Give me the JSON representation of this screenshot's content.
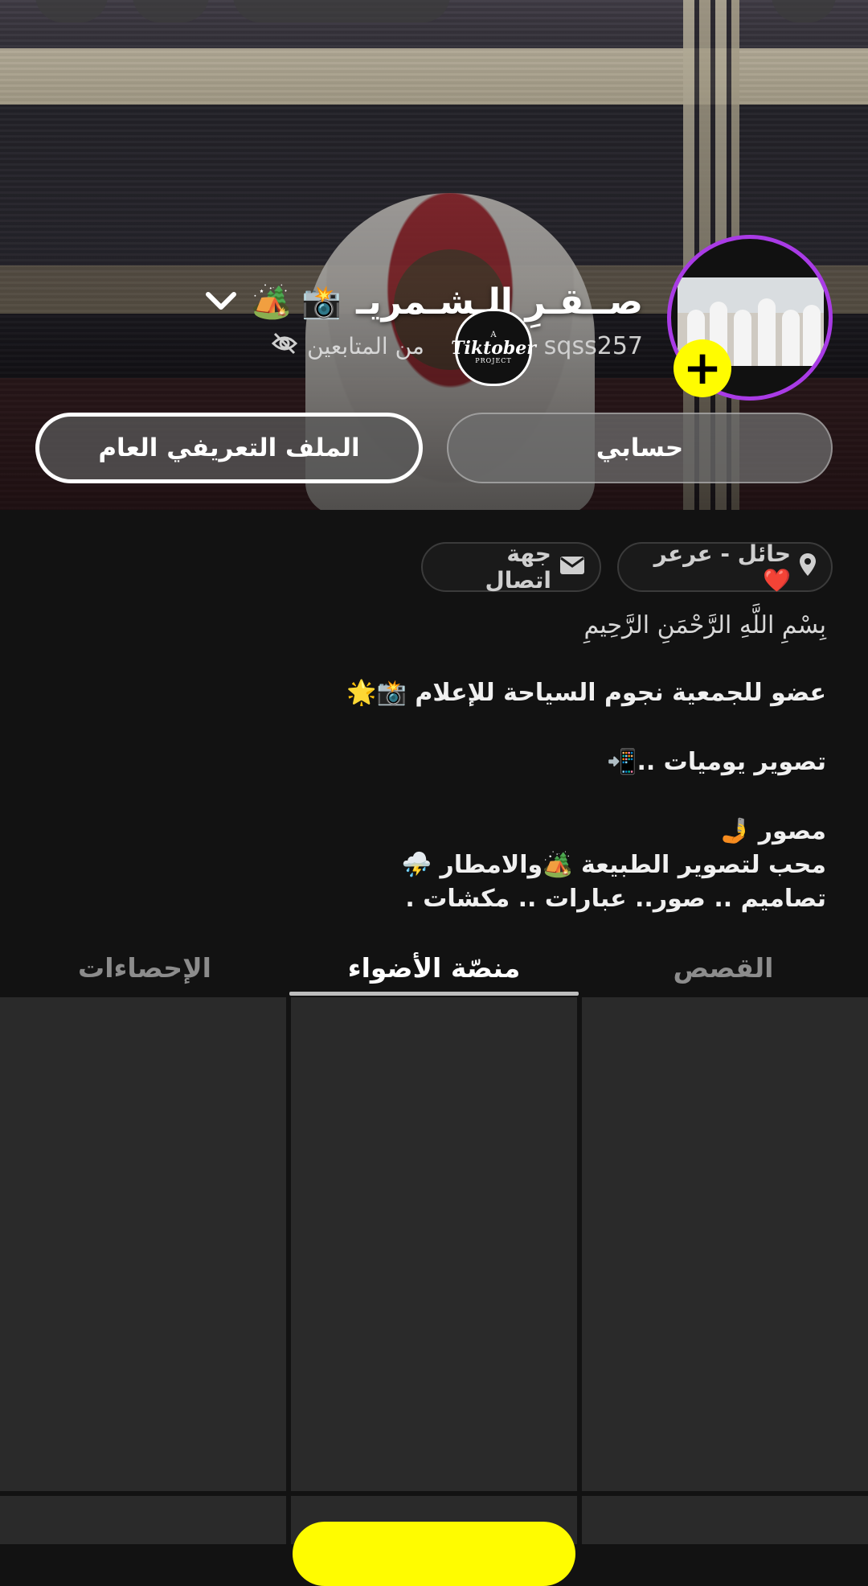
{
  "profile": {
    "display_name": "صــقـرِ الـشـمريـ",
    "name_emojis": "🏕️ 📸",
    "handle": "sqss257",
    "followers_hidden_label": "من المتابعين",
    "badge": {
      "top": "A",
      "main": "Tiktober",
      "bottom": "PROJECT"
    }
  },
  "buttons": {
    "account": "حسابي",
    "public_profile": "الملف التعريفي العام"
  },
  "chips": {
    "location": "حائل - عرعر❤️",
    "contact": "جهة اتصال"
  },
  "bio": {
    "bismillah": "بِسْمِ اللَّهِ الرَّحْمَنِ الرَّحِيمِ",
    "line1": "عضو للجمعية نجوم السياحة للإعلام 📸🌟",
    "line2": "تصوير يوميات ..📲",
    "line3": "مصور 🤳",
    "line4": "محب لتصوير الطبيعة 🏕️والامطار ⛈️",
    "line5": "تصاميم .. صور.. عبارات .. مكشات ."
  },
  "tabs": [
    {
      "label": "القصص",
      "active": false
    },
    {
      "label": "منصّة الأضواء",
      "active": true
    },
    {
      "label": "الإحصاءات",
      "active": false
    }
  ],
  "colors": {
    "accent": "#fffc00",
    "avatar_ring": "#a93be6"
  }
}
